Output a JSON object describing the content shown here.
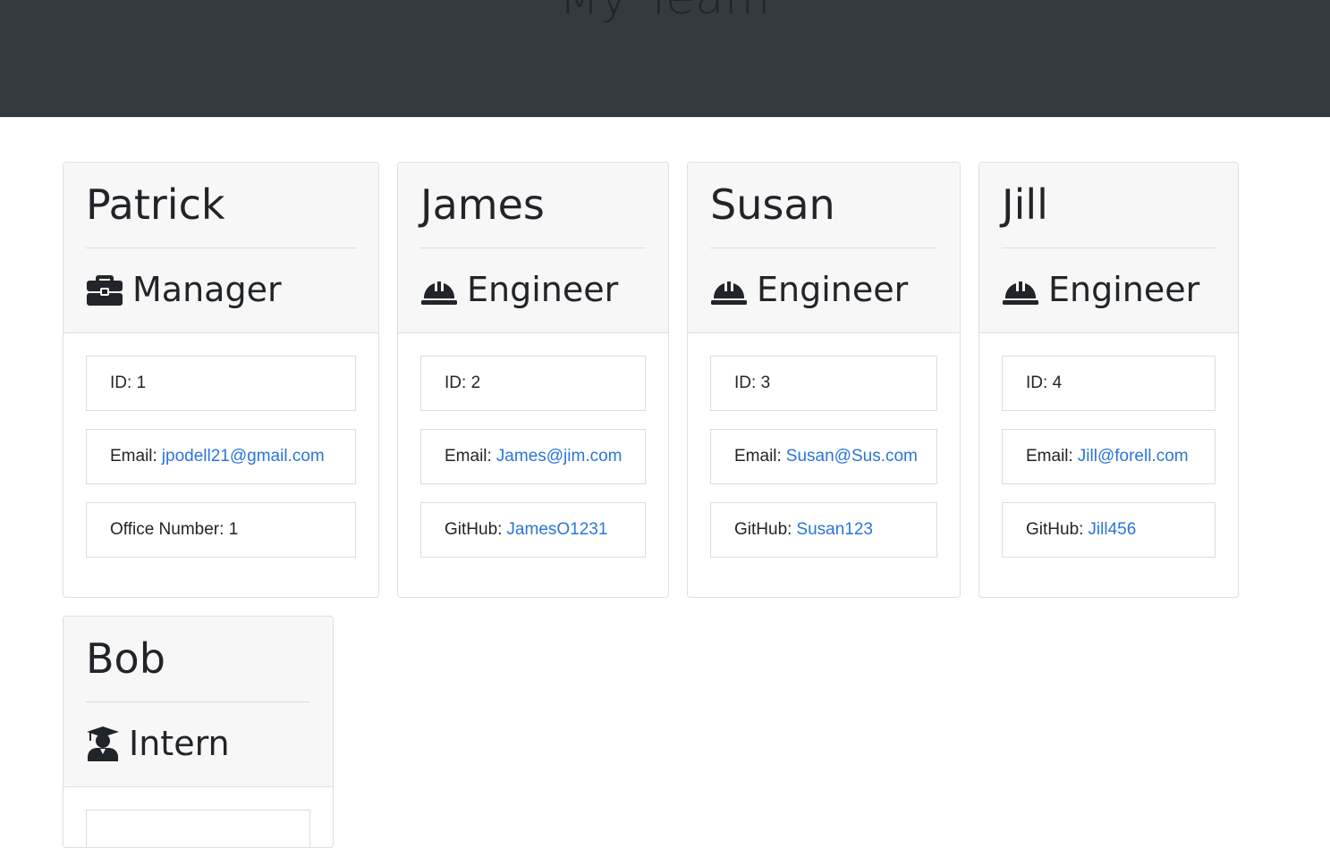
{
  "header": {
    "title": "My Team"
  },
  "employees": [
    {
      "name": "Patrick",
      "role": "Manager",
      "role_icon": "briefcase-icon",
      "id_label": "ID:",
      "id": "1",
      "email_label": "Email:",
      "email": "jpodell21@gmail.com",
      "extra_label": "Office Number:",
      "extra_value": "1",
      "extra_is_link": false
    },
    {
      "name": "James",
      "role": "Engineer",
      "role_icon": "hard-hat-icon",
      "id_label": "ID:",
      "id": "2",
      "email_label": "Email:",
      "email": "James@jim.com",
      "extra_label": "GitHub:",
      "extra_value": "JamesO1231",
      "extra_is_link": true
    },
    {
      "name": "Susan",
      "role": "Engineer",
      "role_icon": "hard-hat-icon",
      "id_label": "ID:",
      "id": "3",
      "email_label": "Email:",
      "email": "Susan@Sus.com",
      "extra_label": "GitHub:",
      "extra_value": "Susan123",
      "extra_is_link": true
    },
    {
      "name": "Jill",
      "role": "Engineer",
      "role_icon": "hard-hat-icon",
      "id_label": "ID:",
      "id": "4",
      "email_label": "Email:",
      "email": "Jill@forell.com",
      "extra_label": "GitHub:",
      "extra_value": "Jill456",
      "extra_is_link": true
    },
    {
      "name": "Bob",
      "role": "Intern",
      "role_icon": "graduate-icon"
    }
  ],
  "colors": {
    "header_bg": "#343a40",
    "link": "#2a76d9",
    "card_header_bg": "#f7f7f7"
  }
}
